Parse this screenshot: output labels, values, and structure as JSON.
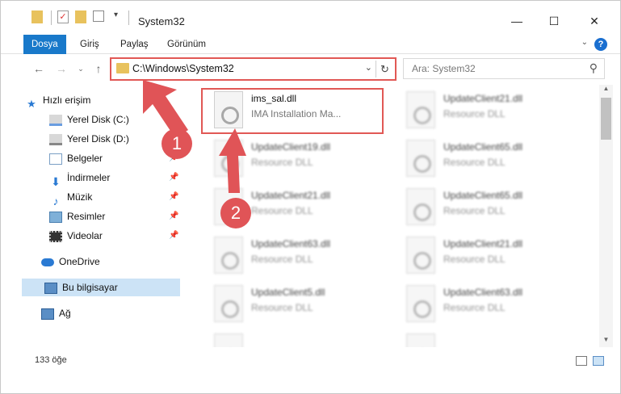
{
  "window": {
    "title": "System32"
  },
  "ribbon": {
    "tabs": [
      "Dosya",
      "Giriş",
      "Paylaş",
      "Görünüm"
    ]
  },
  "address": {
    "path": "C:\\Windows\\System32",
    "search_placeholder": "Ara: System32"
  },
  "nav": {
    "items": [
      {
        "label": "Hızlı erişim",
        "icon": "star-icon",
        "pinned": false
      },
      {
        "label": "Yerel Disk (C:)",
        "icon": "drive-icon",
        "pinned": true
      },
      {
        "label": "Yerel Disk (D:)",
        "icon": "drive-icon",
        "pinned": true
      },
      {
        "label": "Belgeler",
        "icon": "document-icon",
        "pinned": true
      },
      {
        "label": "İndirmeler",
        "icon": "download-icon",
        "pinned": true
      },
      {
        "label": "Müzik",
        "icon": "music-icon",
        "pinned": true
      },
      {
        "label": "Resimler",
        "icon": "picture-icon",
        "pinned": true
      },
      {
        "label": "Videolar",
        "icon": "video-icon",
        "pinned": true
      },
      {
        "label": "OneDrive",
        "icon": "cloud-icon",
        "pinned": false
      },
      {
        "label": "Bu bilgisayar",
        "icon": "computer-icon",
        "pinned": false
      },
      {
        "label": "Ağ",
        "icon": "network-icon",
        "pinned": false
      }
    ]
  },
  "files": [
    {
      "name": "ims_sal.dll",
      "desc": "IMA Installation Ma..."
    },
    {
      "name": "UpdateClient21.dll",
      "desc": "Resource DLL"
    },
    {
      "name": "UpdateClient19.dll",
      "desc": "Resource DLL"
    },
    {
      "name": "UpdateClient65.dll",
      "desc": "Resource DLL"
    },
    {
      "name": "UpdateClient21.dll",
      "desc": "Resource DLL"
    },
    {
      "name": "UpdateClient65.dll",
      "desc": "Resource DLL"
    },
    {
      "name": "UpdateClient63.dll",
      "desc": "Resource DLL"
    },
    {
      "name": "UpdateClient21.dll",
      "desc": "Resource DLL"
    },
    {
      "name": "UpdateClient5.dll",
      "desc": "Resource DLL"
    },
    {
      "name": "UpdateClient63.dll",
      "desc": "Resource DLL"
    }
  ],
  "status": {
    "count": "133 öğe"
  },
  "annotations": {
    "step1": "1",
    "step2": "2"
  },
  "colors": {
    "accent": "#1979ca",
    "highlight": "#e15855"
  }
}
